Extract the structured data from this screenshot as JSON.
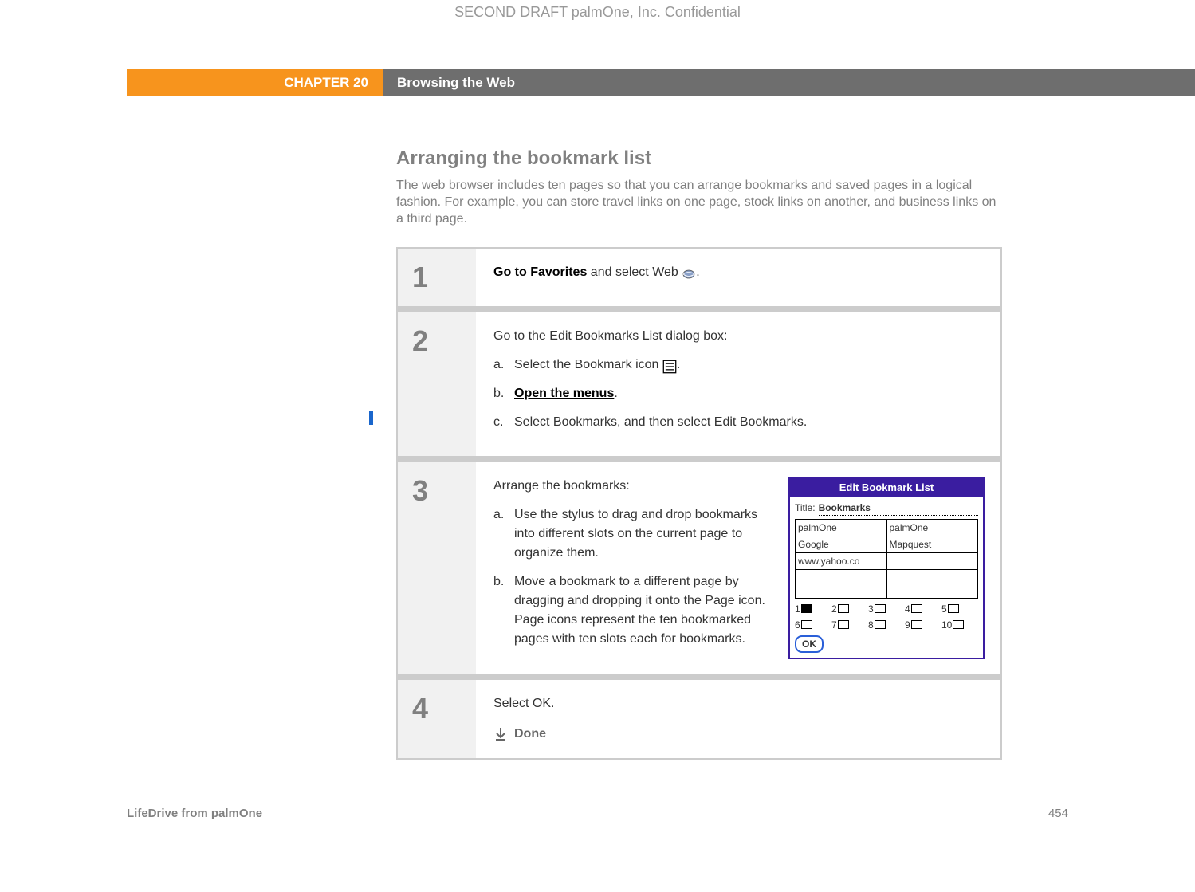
{
  "watermark": "SECOND DRAFT palmOne, Inc.  Confidential",
  "chapter": {
    "number": "CHAPTER 20",
    "title": "Browsing the Web"
  },
  "section": {
    "heading": "Arranging the bookmark list",
    "intro": "The web browser includes ten pages so that you can arrange bookmarks and saved pages in a logical fashion. For example, you can store travel links on one page, stock links on another, and business links on a third page."
  },
  "steps": [
    {
      "num": "1",
      "link": "Go to Favorites",
      "rest": " and select Web ",
      "period": "."
    },
    {
      "num": "2",
      "lead": "Go to the Edit Bookmarks List dialog box:",
      "subs": [
        {
          "letter": "a.",
          "pre": "Select the Bookmark icon ",
          "post": "."
        },
        {
          "letter": "b.",
          "link": "Open the menus",
          "post": "."
        },
        {
          "letter": "c.",
          "text": "Select Bookmarks, and then select Edit Bookmarks."
        }
      ]
    },
    {
      "num": "3",
      "lead": "Arrange the bookmarks:",
      "subs": [
        {
          "letter": "a.",
          "text": "Use the stylus to drag and drop bookmarks into different slots on the current page to organize them."
        },
        {
          "letter": "b.",
          "text": "Move a bookmark to a different page by dragging and dropping it onto the Page icon. Page icons represent the ten bookmarked pages with ten slots each for bookmarks."
        }
      ]
    },
    {
      "num": "4",
      "lead": "Select OK.",
      "done": "Done"
    }
  ],
  "dialog": {
    "title": "Edit Bookmark List",
    "fieldLabel": "Title:",
    "fieldValue": "Bookmarks",
    "cells": [
      "palmOne",
      "palmOne",
      "Google",
      "Mapquest",
      "www.yahoo.co",
      "",
      "",
      "",
      "",
      ""
    ],
    "pages": [
      "1",
      "2",
      "3",
      "4",
      "5",
      "6",
      "7",
      "8",
      "9",
      "10"
    ],
    "ok": "OK"
  },
  "footer": {
    "left": "LifeDrive from palmOne",
    "right": "454"
  }
}
